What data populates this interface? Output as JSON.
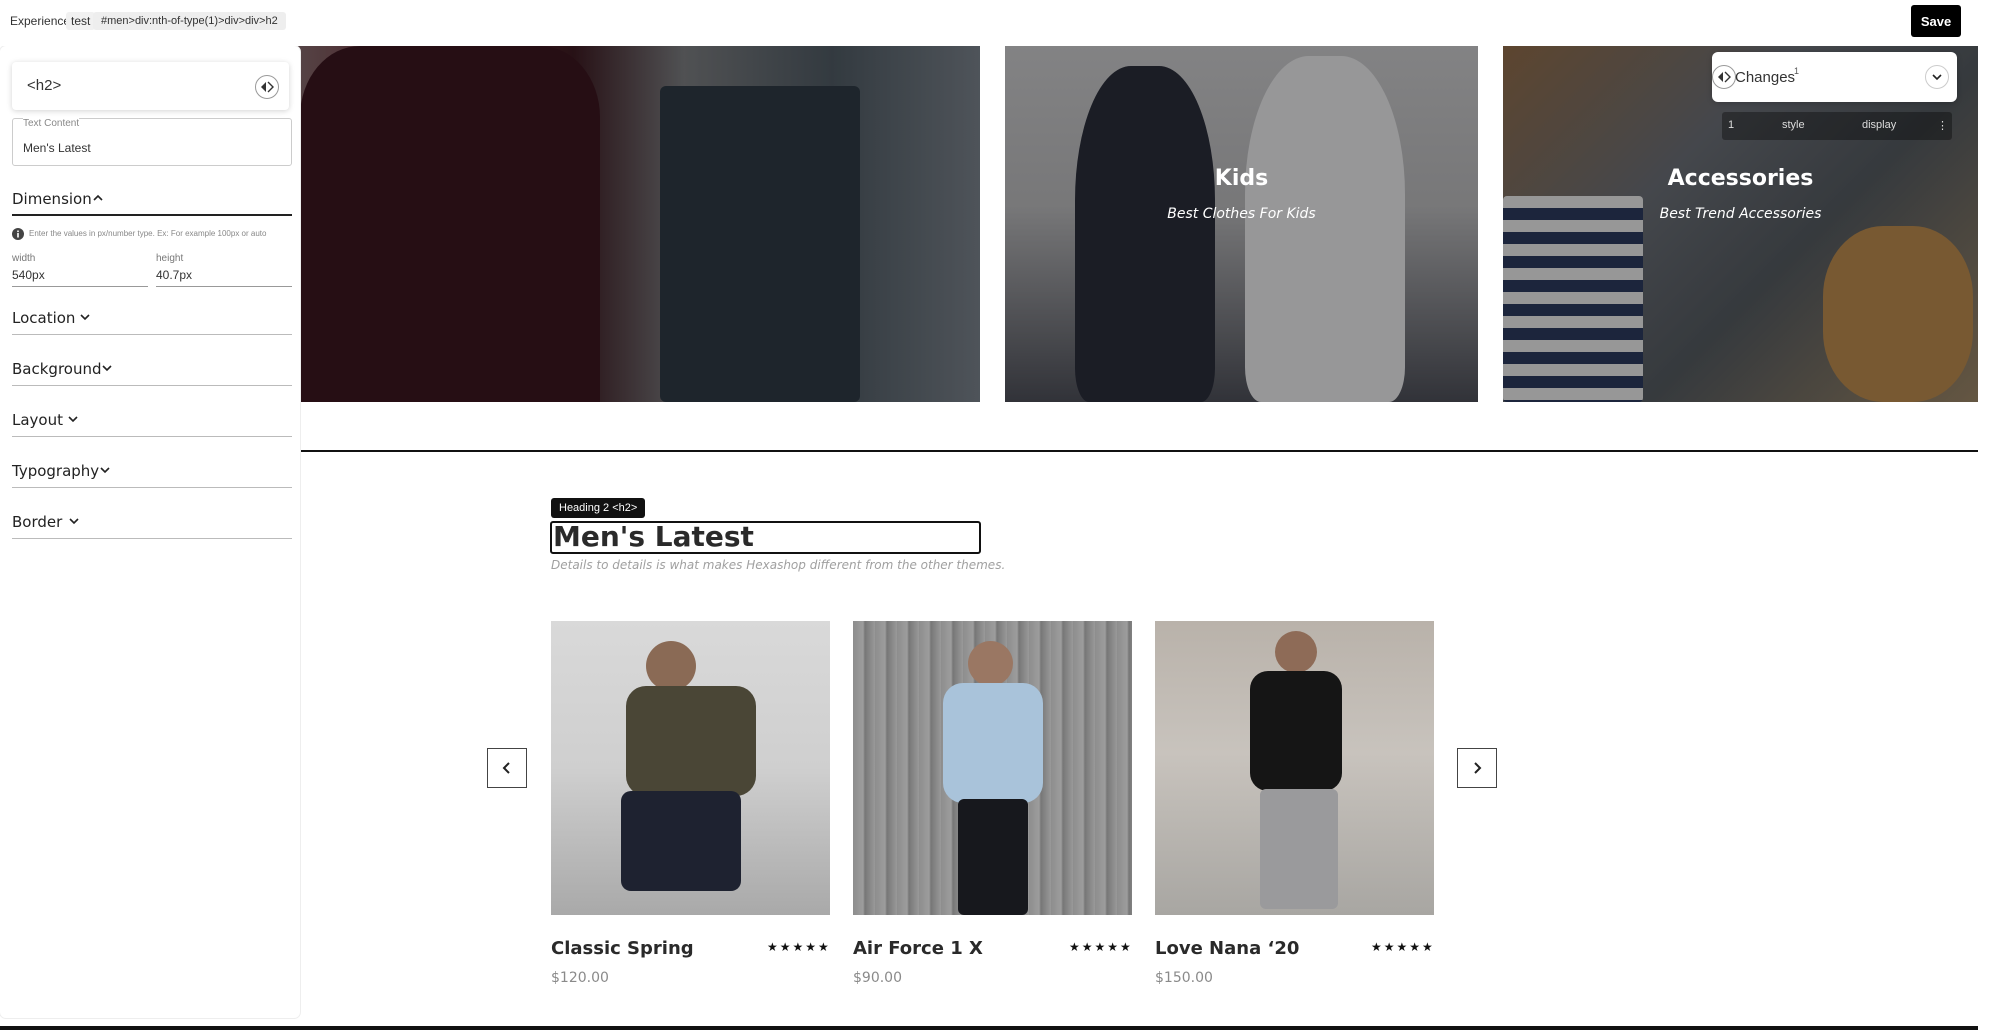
{
  "topbar": {
    "experience_label": "Experience",
    "experience_name": "test",
    "selector_path": "#men>div:nth-of-type(1)>div>div>h2",
    "save_label": "Save"
  },
  "panel": {
    "element_tag": "<h2>",
    "text_content_label": "Text Content",
    "text_content_value": "Men's Latest",
    "sections": {
      "dimension": "Dimension",
      "location": "Location",
      "background": "Background",
      "layout": "Layout",
      "typography": "Typography",
      "border": "Border"
    },
    "dimension_hint": "Enter the values in px/number type. Ex: For example 100px or auto",
    "width_label": "width",
    "width_value": "540px",
    "height_label": "height",
    "height_value": "40.7px"
  },
  "changes": {
    "title": "Changes",
    "count": "1",
    "row": {
      "index": "1",
      "type": "style",
      "property": "display"
    }
  },
  "banners": [
    {
      "title": "Kids",
      "subtitle": "Best Clothes For Kids"
    },
    {
      "title": "Accessories",
      "subtitle": "Best Trend Accessories"
    }
  ],
  "section": {
    "tag_label": "Heading 2 <h2>",
    "heading": "Men's Latest",
    "subheading": "Details to details is what makes Hexashop different from the other themes."
  },
  "products": [
    {
      "name": "Classic Spring",
      "price": "$120.00",
      "stars": "★★★★★",
      "rating": 5
    },
    {
      "name": "Air Force 1 X",
      "price": "$90.00",
      "stars": "★★★★★",
      "rating": 5
    },
    {
      "name": "Love Nana ‘20",
      "price": "$150.00",
      "stars": "★★★★★",
      "rating": 5
    }
  ],
  "icons": {
    "prev": "chevron-left-icon",
    "next": "chevron-right-icon",
    "info": "info-icon",
    "toggle": "code-toggle-icon",
    "expand": "chevron-down-icon"
  }
}
